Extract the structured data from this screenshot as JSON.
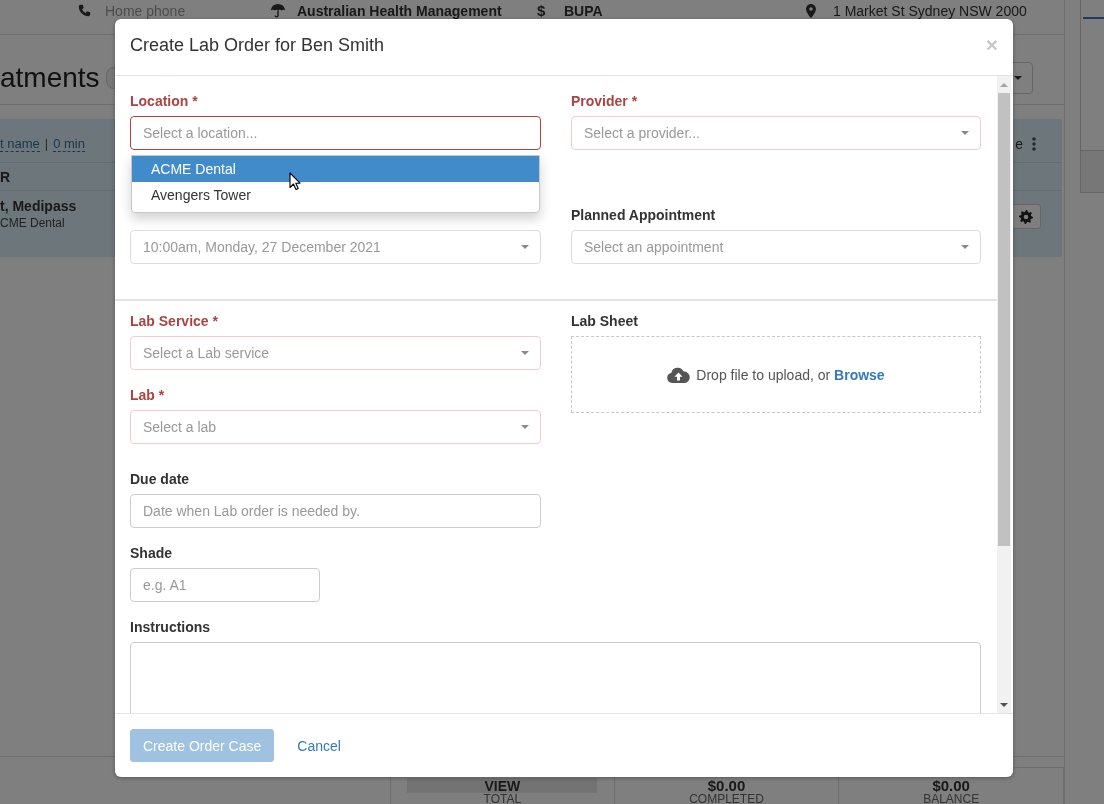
{
  "background": {
    "contact_bar": [
      {
        "kind": "phone",
        "text": "Home phone"
      },
      {
        "kind": "umbrella",
        "text": "Australian Health Management"
      },
      {
        "kind": "dollar",
        "glyph": "$",
        "text": "BUPA"
      },
      {
        "kind": "pin",
        "text": "1 Market St Sydney NSW 2000"
      }
    ],
    "heading": "atments",
    "panel": {
      "links": [
        "t name",
        "0 min"
      ],
      "separator": "|",
      "side_text": "e",
      "column_header": "R",
      "entry": {
        "title": "t, Medipass",
        "subtitle": "CME Dental"
      }
    },
    "stats": [
      {
        "kind": "button",
        "value": "VIEW",
        "label": "TOTAL"
      },
      {
        "kind": "amount",
        "value": "$0.00",
        "label": "COMPLETED"
      },
      {
        "kind": "amount",
        "value": "$0.00",
        "label": "BALANCE"
      }
    ]
  },
  "modal": {
    "title": "Create Lab Order for Ben Smith",
    "close": "×",
    "top_rows": [
      {
        "left": {
          "kind": "select",
          "label": "Location *",
          "required": true,
          "open": true,
          "placeholder": "Select a location...",
          "options": [
            {
              "label": "ACME Dental",
              "selected": true
            },
            {
              "label": "Avengers Tower",
              "selected": false
            }
          ]
        },
        "right": {
          "kind": "select",
          "label": "Provider *",
          "required": true,
          "open": false,
          "placeholder": "Select a provider..."
        }
      },
      {
        "left": {
          "kind": "select",
          "required": false,
          "open": false,
          "disabled": true,
          "value": "10:00am, Monday, 27 December 2021"
        },
        "right": {
          "kind": "select",
          "label": "Planned Appointment",
          "required": false,
          "open": false,
          "placeholder": "Select an appointment"
        }
      }
    ],
    "lower": {
      "left": [
        {
          "kind": "select",
          "label": "Lab Service *",
          "required": true,
          "open": false,
          "placeholder": "Select a Lab service"
        },
        {
          "kind": "select",
          "label": "Lab *",
          "required": true,
          "open": false,
          "placeholder": "Select a lab"
        },
        {
          "kind": "text",
          "label": "Due date",
          "required": false,
          "placeholder": "Date when Lab order is needed by."
        },
        {
          "kind": "text",
          "label": "Shade",
          "required": false,
          "placeholder": "e.g. A1"
        }
      ],
      "right": [
        {
          "kind": "dropzone",
          "label": "Lab Sheet",
          "required": false,
          "prompt": "Drop file to upload, or",
          "link": "Browse"
        }
      ]
    },
    "instructions": {
      "kind": "textarea",
      "label": "Instructions",
      "required": false
    },
    "buttons": [
      {
        "kind": "primary",
        "label": "Create Order Case",
        "disabled": true
      },
      {
        "kind": "link",
        "label": "Cancel",
        "disabled": false
      }
    ]
  }
}
